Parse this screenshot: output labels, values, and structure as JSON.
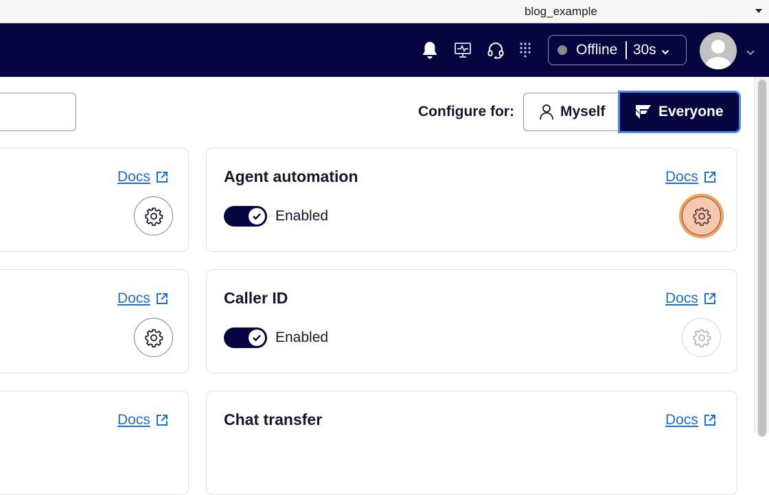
{
  "window": {
    "title": "blog_example"
  },
  "navbar": {
    "icons": [
      "bell-icon",
      "monitor-pulse-icon",
      "headset-icon",
      "dialpad-icon"
    ],
    "status": {
      "label": "Offline",
      "timer": "30s",
      "dot_color": "#8a8a8a"
    },
    "avatar_alt": "User avatar"
  },
  "toolbar": {
    "configure_label": "Configure for:",
    "options": [
      {
        "label": "Myself",
        "selected": false
      },
      {
        "label": "Everyone",
        "selected": true
      }
    ]
  },
  "cards": [
    {
      "title": "",
      "docs_label": "Docs",
      "has_toggle": false,
      "settings_state": "normal"
    },
    {
      "title": "Agent automation",
      "docs_label": "Docs",
      "toggle_label": "Enabled",
      "enabled": true,
      "settings_state": "focused"
    },
    {
      "title": "",
      "docs_label": "Docs",
      "has_toggle": false,
      "settings_state": "normal"
    },
    {
      "title": "Caller ID",
      "docs_label": "Docs",
      "toggle_label": "Enabled",
      "enabled": true,
      "settings_state": "disabled"
    },
    {
      "title": "",
      "docs_label": "Docs"
    },
    {
      "title": "Chat transfer",
      "docs_label": "Docs"
    }
  ],
  "colors": {
    "navy": "#070540",
    "link": "#1a6fd4",
    "focus_ring": "#f4a25a",
    "selected_outline": "#4a8ae8"
  }
}
